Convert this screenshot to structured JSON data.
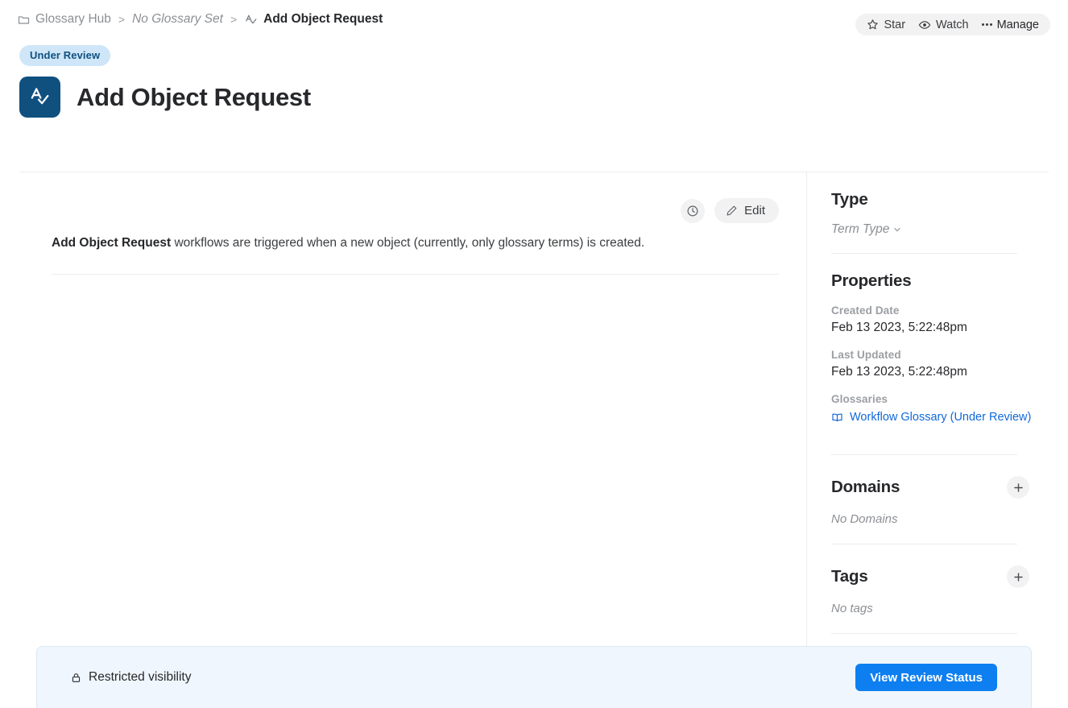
{
  "breadcrumb": {
    "items": [
      {
        "label": "Glossary Hub",
        "icon": "folder-icon",
        "style": "normal"
      },
      {
        "label": "No Glossary Set",
        "icon": "",
        "style": "italic"
      },
      {
        "label": "Add Object Request",
        "icon": "workflow-icon",
        "style": "current"
      }
    ],
    "separator": ">"
  },
  "top_actions": {
    "star": "Star",
    "watch": "Watch",
    "manage": "Manage"
  },
  "header": {
    "badge": "Under Review",
    "title": "Add Object Request",
    "icon": "workflow-app-icon"
  },
  "main": {
    "toolbar": {
      "history_icon": "clock-icon",
      "edit_label": "Edit"
    },
    "description": {
      "bold_prefix": "Add Object Request",
      "rest": " workflows are triggered when a new object (currently, only glossary terms) is created."
    }
  },
  "sidebar": {
    "type": {
      "heading": "Type",
      "value": "Term Type"
    },
    "properties": {
      "heading": "Properties",
      "fields": [
        {
          "label": "Created Date",
          "value": "Feb 13 2023, 5:22:48pm"
        },
        {
          "label": "Last Updated",
          "value": "Feb 13 2023, 5:22:48pm"
        }
      ],
      "glossaries_label": "Glossaries",
      "glossary_link": "Workflow Glossary (Under Review)"
    },
    "domains": {
      "heading": "Domains",
      "empty": "No Domains",
      "add_label": "+"
    },
    "tags": {
      "heading": "Tags",
      "empty": "No tags",
      "add_label": "+"
    }
  },
  "bottom_bar": {
    "visibility_text": "Restricted visibility",
    "lock_icon": "lock-icon",
    "button_label": "View Review Status"
  },
  "colors": {
    "brand_navy": "#10507f",
    "badge_bg": "#cfe6f8",
    "link_blue": "#1168d9",
    "primary_blue": "#0d7ff0",
    "panel_bg": "#eff6fd"
  }
}
